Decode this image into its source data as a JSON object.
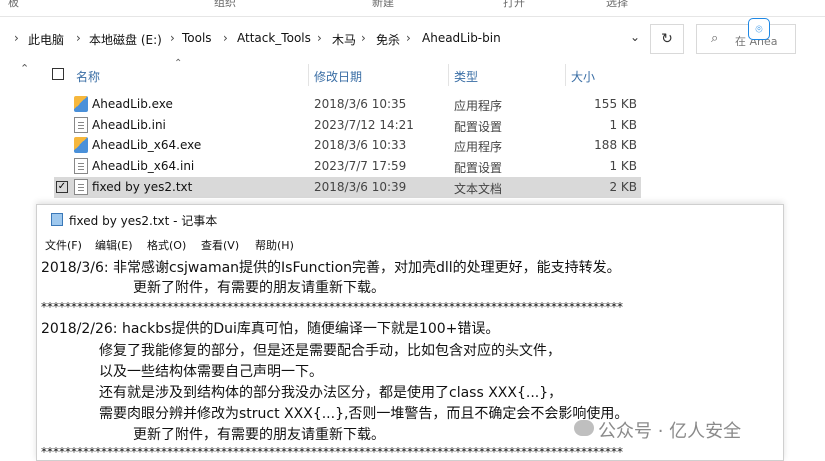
{
  "ribbon": {
    "labels": [
      "板",
      "组织",
      "新建",
      "打开",
      "选择"
    ]
  },
  "address": {
    "crumbs": [
      "此电脑",
      "本地磁盘 (E:)",
      "Tools",
      "Attack_Tools",
      "木马",
      "免杀",
      "AheadLib-bin"
    ],
    "separator": "›",
    "search_placeholder": "在 Ahea"
  },
  "columns": {
    "name": "名称",
    "date": "修改日期",
    "type": "类型",
    "size": "大小"
  },
  "files": [
    {
      "name": "AheadLib.exe",
      "date": "2018/3/6 10:35",
      "type": "应用程序",
      "size": "155 KB",
      "icon": "exe-icon"
    },
    {
      "name": "AheadLib.ini",
      "date": "2023/7/12 14:21",
      "type": "配置设置",
      "size": "1 KB",
      "icon": "ini-icon"
    },
    {
      "name": "AheadLib_x64.exe",
      "date": "2018/3/6 10:33",
      "type": "应用程序",
      "size": "188 KB",
      "icon": "exe-icon"
    },
    {
      "name": "AheadLib_x64.ini",
      "date": "2023/7/7 17:59",
      "type": "配置设置",
      "size": "1 KB",
      "icon": "ini-icon"
    },
    {
      "name": "fixed by yes2.txt",
      "date": "2018/3/6 10:39",
      "type": "文本文档",
      "size": "2 KB",
      "icon": "txt-icon",
      "selected": true
    }
  ],
  "notepad": {
    "title": "fixed by yes2.txt - 记事本",
    "menu": [
      "文件(F)",
      "编辑(E)",
      "格式(O)",
      "查看(V)",
      "帮助(H)"
    ],
    "lines": [
      "2018/3/6:  非常感谢csjwaman提供的IsFunction完善，对加壳dll的处理更好，能支持转发。",
      "更新了附件，有需要的朋友请重新下载。",
      "*************************************************************************************************",
      "2018/2/26:  hackbs提供的Dui库真可怕，随便编译一下就是100+错误。",
      "修复了我能修复的部分，但是还是需要配合手动，比如包含对应的头文件，",
      "以及一些结构体需要自己声明一下。",
      "还有就是涉及到结构体的部分我没办法区分，都是使用了class XXX{...}，",
      "需要肉眼分辨并修改为struct XXX{...},否则一堆警告，而且不确定会不会影响使用。",
      "更新了附件，有需要的朋友请重新下载。",
      "*************************************************************************************************"
    ]
  },
  "watermark": "公众号 · 亿人安全"
}
